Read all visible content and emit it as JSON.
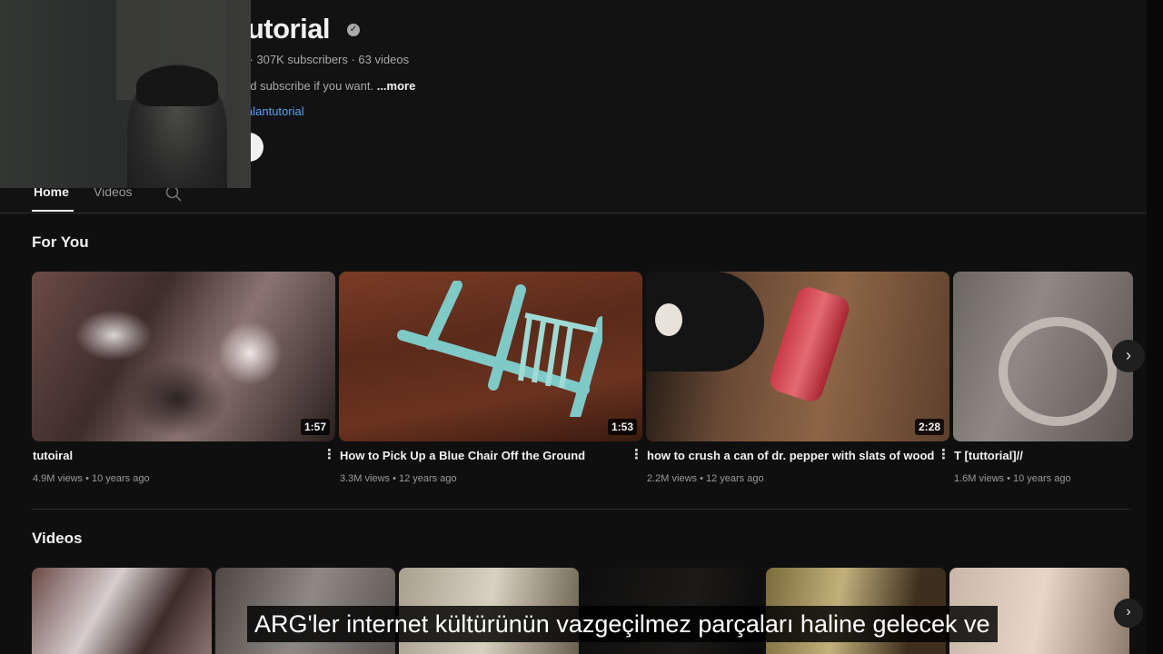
{
  "channel": {
    "title": "tutorial",
    "meta": "l · 307K subscribers · 63 videos",
    "description": "nd subscribe if you want. ",
    "more_label": "...more",
    "link": "alantutorial"
  },
  "tabs": {
    "home": "Home",
    "videos": "Videos"
  },
  "sections": {
    "for_you": "For You",
    "videos": "Videos"
  },
  "for_you_videos": [
    {
      "title": "tutoiral",
      "meta": "4.9M views • 10 years ago",
      "duration": "1:57"
    },
    {
      "title": "How to Pick Up a Blue Chair Off the Ground",
      "meta": "3.3M views • 12 years ago",
      "duration": "1:53"
    },
    {
      "title": "how to crush a can of dr. pepper with slats of wood",
      "meta": "2.2M views • 12 years ago",
      "duration": "2:28"
    },
    {
      "title": "T [tuttorial]//",
      "meta": "1.6M views • 10 years ago",
      "duration": ""
    }
  ],
  "icons": {
    "verified": "check-badge-icon",
    "search": "search-icon",
    "next": "chevron-right-icon",
    "more": "kebab-menu-icon"
  },
  "colors": {
    "background": "#0f0f0f",
    "link": "#5aa1f5",
    "text": "#f1f1f1",
    "secondary_text": "#9a9a9a"
  },
  "subtitle": "ARG'ler internet kültürünün vazgeçilmez parçaları haline gelecek ve"
}
